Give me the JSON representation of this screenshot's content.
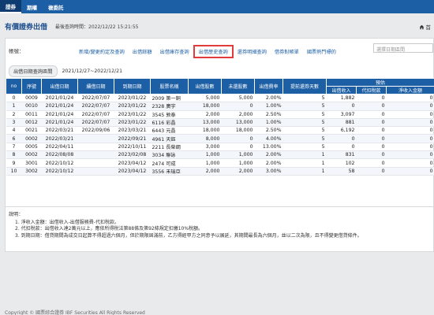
{
  "topnav": {
    "tabs": [
      "證券",
      "期權",
      "複委託"
    ]
  },
  "header": {
    "title": "有價證券出借",
    "last_update": "最後查詢時間：2022/12/22 15:21:55",
    "home_label": "首"
  },
  "account": {
    "label": "帳號："
  },
  "subtabs": [
    "新增/變更約定及查詢",
    "出借餘額",
    "出借庫存查詢",
    "出借歷史查詢",
    "還券明細查詢",
    "借券對帳單",
    "國票熱門標的"
  ],
  "active_subtab": 3,
  "search": {
    "placeholder": "選擇日期區間"
  },
  "filter": {
    "label": "出借日期查詢區間",
    "value": "2021/12/27~2022/12/21"
  },
  "table": {
    "headers": {
      "no": "no",
      "seq": "序號",
      "lend_date": "出借日期",
      "renew_date": "續借日期",
      "due_date": "到期日期",
      "stock": "股票名稱",
      "lend_qty": "出借股數",
      "unreturned": "未還股數",
      "rate": "出借費率",
      "early_days": "提前還券天數",
      "est_group": "預估",
      "income": "出借收入",
      "withholding": "代扣稅款",
      "net_income": "淨收入金額"
    },
    "rows": [
      {
        "no": "0",
        "seq": "0009",
        "lend": "2021/01/24",
        "renew": "2022/07/07",
        "due": "2023/01/22",
        "stock": "2009 第一銅",
        "qty": "5,000",
        "unret": "5,000",
        "rate": "2.00%",
        "early": "5",
        "income": "1,882",
        "wh": "0",
        "net": "0"
      },
      {
        "no": "1",
        "seq": "0010",
        "lend": "2021/01/24",
        "renew": "2022/07/07",
        "due": "2023/01/22",
        "stock": "2328 廣宇",
        "qty": "18,000",
        "unret": "0",
        "rate": "1.00%",
        "early": "5",
        "income": "0",
        "wh": "0",
        "net": "0"
      },
      {
        "no": "2",
        "seq": "0011",
        "lend": "2021/01/24",
        "renew": "2022/07/07",
        "due": "2023/01/22",
        "stock": "3545 敦泰",
        "qty": "2,000",
        "unret": "2,000",
        "rate": "2.50%",
        "early": "5",
        "income": "3,097",
        "wh": "0",
        "net": "0"
      },
      {
        "no": "3",
        "seq": "0012",
        "lend": "2021/01/24",
        "renew": "2022/07/07",
        "due": "2023/01/22",
        "stock": "6116 彩晶",
        "qty": "13,000",
        "unret": "13,000",
        "rate": "1.00%",
        "early": "5",
        "income": "881",
        "wh": "0",
        "net": "0"
      },
      {
        "no": "4",
        "seq": "0021",
        "lend": "2022/03/21",
        "renew": "2022/09/06",
        "due": "2023/03/21",
        "stock": "6443 元晶",
        "qty": "18,000",
        "unret": "18,000",
        "rate": "2.50%",
        "early": "5",
        "income": "6,192",
        "wh": "0",
        "net": "0"
      },
      {
        "no": "6",
        "seq": "0002",
        "lend": "2022/03/21",
        "renew": "",
        "due": "2022/09/21",
        "stock": "4961 天鈺",
        "qty": "8,000",
        "unret": "0",
        "rate": "4.00%",
        "early": "5",
        "income": "0",
        "wh": "0",
        "net": "0"
      },
      {
        "no": "7",
        "seq": "0005",
        "lend": "2022/04/11",
        "renew": "",
        "due": "2022/10/11",
        "stock": "2211 長榮鋼",
        "qty": "3,000",
        "unret": "0",
        "rate": "13.00%",
        "early": "5",
        "income": "0",
        "wh": "0",
        "net": "0"
      },
      {
        "no": "8",
        "seq": "0002",
        "lend": "2022/08/08",
        "renew": "",
        "due": "2023/02/08",
        "stock": "3034 聯詠",
        "qty": "1,000",
        "unret": "1,000",
        "rate": "2.00%",
        "early": "1",
        "income": "831",
        "wh": "0",
        "net": "0"
      },
      {
        "no": "9",
        "seq": "3001",
        "lend": "2022/10/12",
        "renew": "",
        "due": "2023/04/12",
        "stock": "2474 可成",
        "qty": "1,000",
        "unret": "1,000",
        "rate": "2.00%",
        "early": "1",
        "income": "102",
        "wh": "0",
        "net": "0"
      },
      {
        "no": "10",
        "seq": "3002",
        "lend": "2022/10/12",
        "renew": "",
        "due": "2023/04/12",
        "stock": "3556 禾瑞亞",
        "qty": "2,000",
        "unret": "2,000",
        "rate": "3.00%",
        "early": "1",
        "income": "58",
        "wh": "0",
        "net": "0"
      }
    ]
  },
  "notes": {
    "heading": "說明：",
    "items": [
      "1. 淨收入金額：出借收入-出借服務費-代扣稅款。",
      "2. 代扣稅款：出借收入達2萬元以上，應依所得稅法第88條及第92條規定扣繳10%稅額。",
      "3. 到期日期：借貸期間為成交日起算不得超過六個月，但於期限屆滿前，乙方得經甲方之同意予以展延，其期間最長為六個月，並以二次為限，且不得變更借貸條件。"
    ]
  },
  "footer": {
    "text": "Copyright © 國票綜合證券 IBF Securities All Rights Reserved"
  }
}
